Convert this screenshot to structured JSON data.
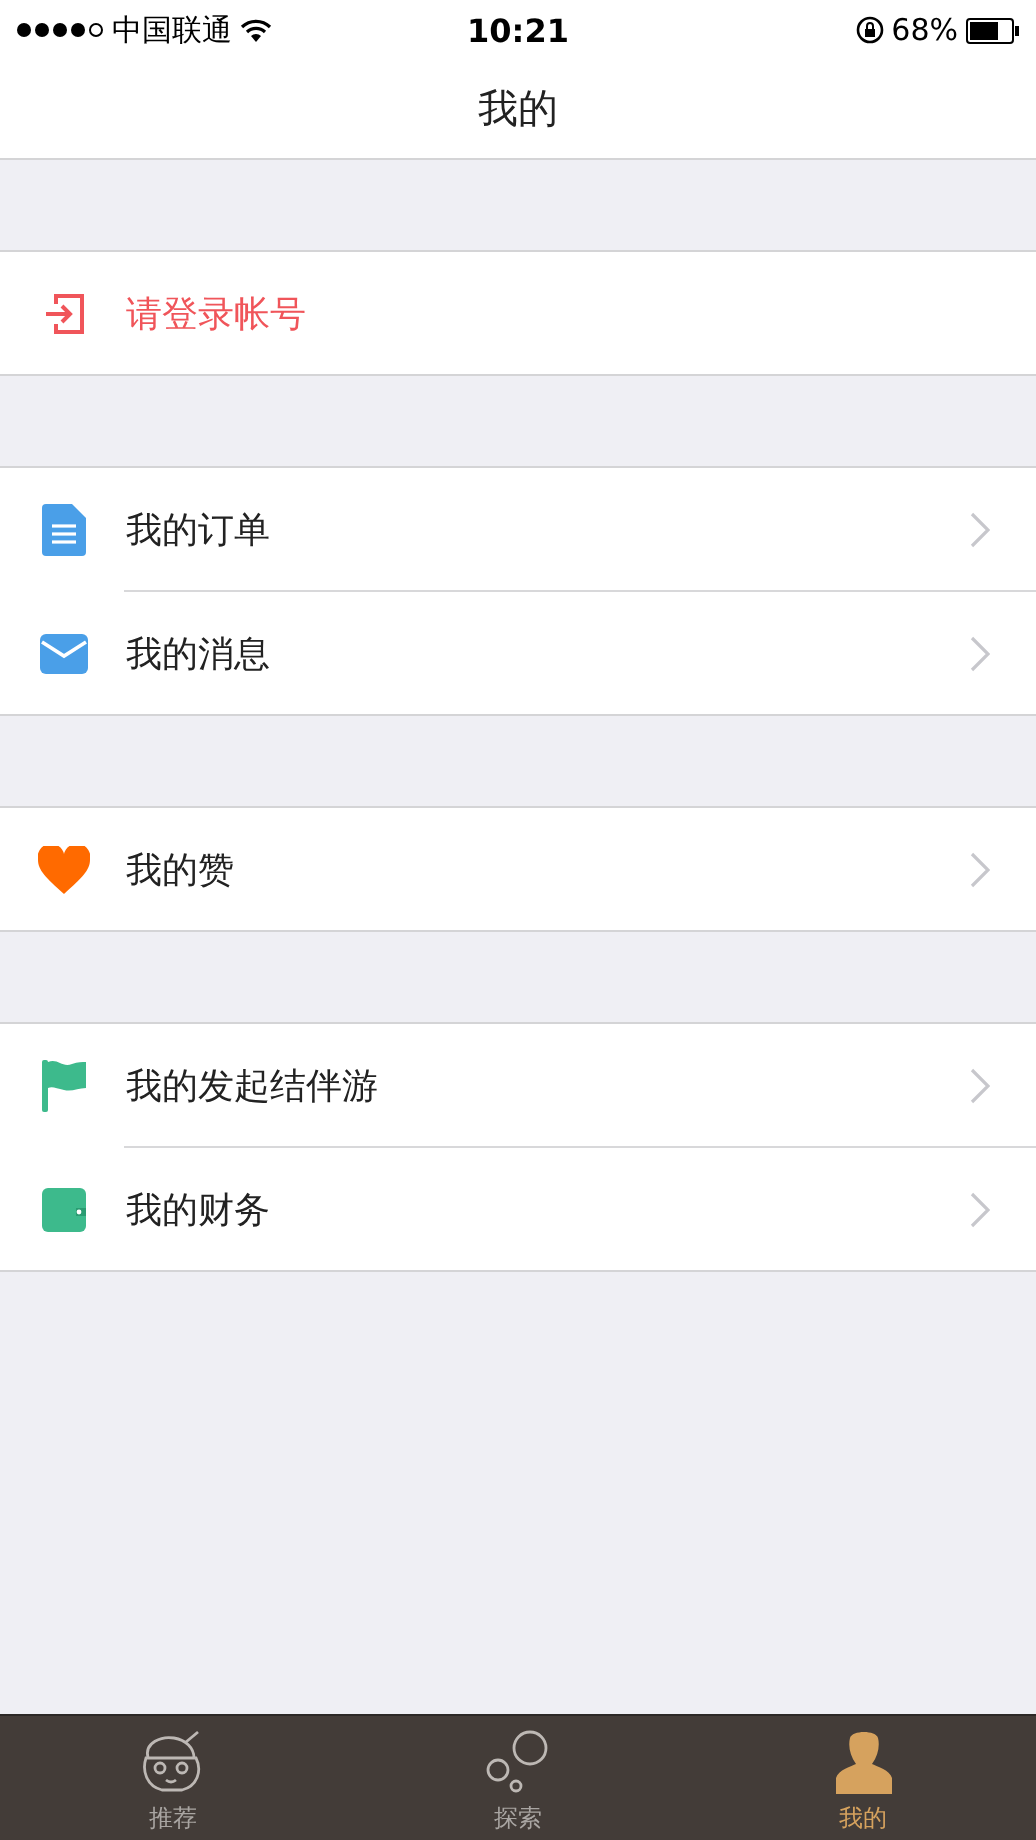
{
  "status_bar": {
    "carrier": "中国联通",
    "time": "10:21",
    "battery": "68%"
  },
  "nav": {
    "title": "我的"
  },
  "login": {
    "label": "请登录帐号"
  },
  "groups": [
    {
      "items": [
        {
          "label": "我的订单"
        },
        {
          "label": "我的消息"
        }
      ]
    },
    {
      "items": [
        {
          "label": "我的赞"
        }
      ]
    },
    {
      "items": [
        {
          "label": "我的发起结伴游"
        },
        {
          "label": "我的财务"
        }
      ]
    }
  ],
  "tabs": [
    {
      "label": "推荐",
      "selected": false
    },
    {
      "label": "探索",
      "selected": false
    },
    {
      "label": "我的",
      "selected": true
    }
  ]
}
